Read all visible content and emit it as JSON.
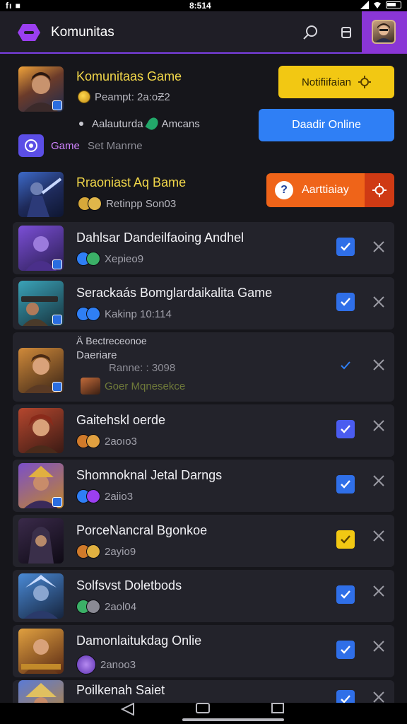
{
  "status": {
    "left": "fı ■",
    "time": "8:514"
  },
  "app": {
    "title": "Komunitas"
  },
  "featured": [
    {
      "title": "Komunitaas Game",
      "subtitle": "Peampt: 2a:oƵ2",
      "bullet": "Aalauturda",
      "bullet_tail": "Amcans",
      "chip_label": "Game",
      "chip_sub": "Set Manrne"
    },
    {
      "title": "Rraoniast Aq Bame",
      "subtitle": "Retinpp Son03"
    }
  ],
  "buttons": {
    "notification": "Notifiifaian",
    "online": "Daadir Online",
    "activity": "Aarttiaiay"
  },
  "rows": [
    {
      "title": "Dahlsar Dandeilfaoing Andhel",
      "meta": "Xepieo9",
      "checked": true,
      "check_color": "#2f6fe8"
    },
    {
      "title": "Serackaás Bomglardaikalita Game",
      "meta": "Kakinp 10:114",
      "checked": true,
      "check_color": "#2f6fe8"
    },
    {
      "title_line1": "Ä Bectreceonoe",
      "title_line2": "Daeriare",
      "meta_line1": "Ranne: : 3098",
      "meta_line2": "Goer Mqnesekce",
      "checked": true,
      "check_color": "none"
    },
    {
      "title": "Gaitehskl oerde",
      "meta": "2aoıo3",
      "checked": true,
      "check_color": "#4a5cf0"
    },
    {
      "title": "Shomnoknal Jetal Darngs",
      "meta": "2aiio3",
      "checked": true,
      "check_color": "#2f6fe8"
    },
    {
      "title": "PorceNancral Bgonkoe",
      "meta": "2ayio9",
      "checked": false,
      "check_color": "#f2c813"
    },
    {
      "title": "Solfsvst Doletbods",
      "meta": "2aol04",
      "checked": true,
      "check_color": "#2f6fe8"
    },
    {
      "title": "Damonlaitukdag Onlie",
      "meta": "2anoo3",
      "checked": true,
      "check_color": "#2f6fe8"
    },
    {
      "title": "Poilkenah Saiet",
      "meta": "",
      "checked": true,
      "check_color": "#2f6fe8"
    }
  ],
  "icons": {
    "menu": "menu-icon",
    "search": "search-icon",
    "bookmark": "bookmark-icon",
    "gear": "gear-icon",
    "check": "check-icon",
    "close": "close-icon",
    "back": "back-icon",
    "home": "home-icon",
    "recents": "recents-icon"
  },
  "colors": {
    "accent": "#7b3fe4",
    "notification": "#f2c813",
    "online": "#2f7ff5",
    "activity": "#ef6419"
  }
}
